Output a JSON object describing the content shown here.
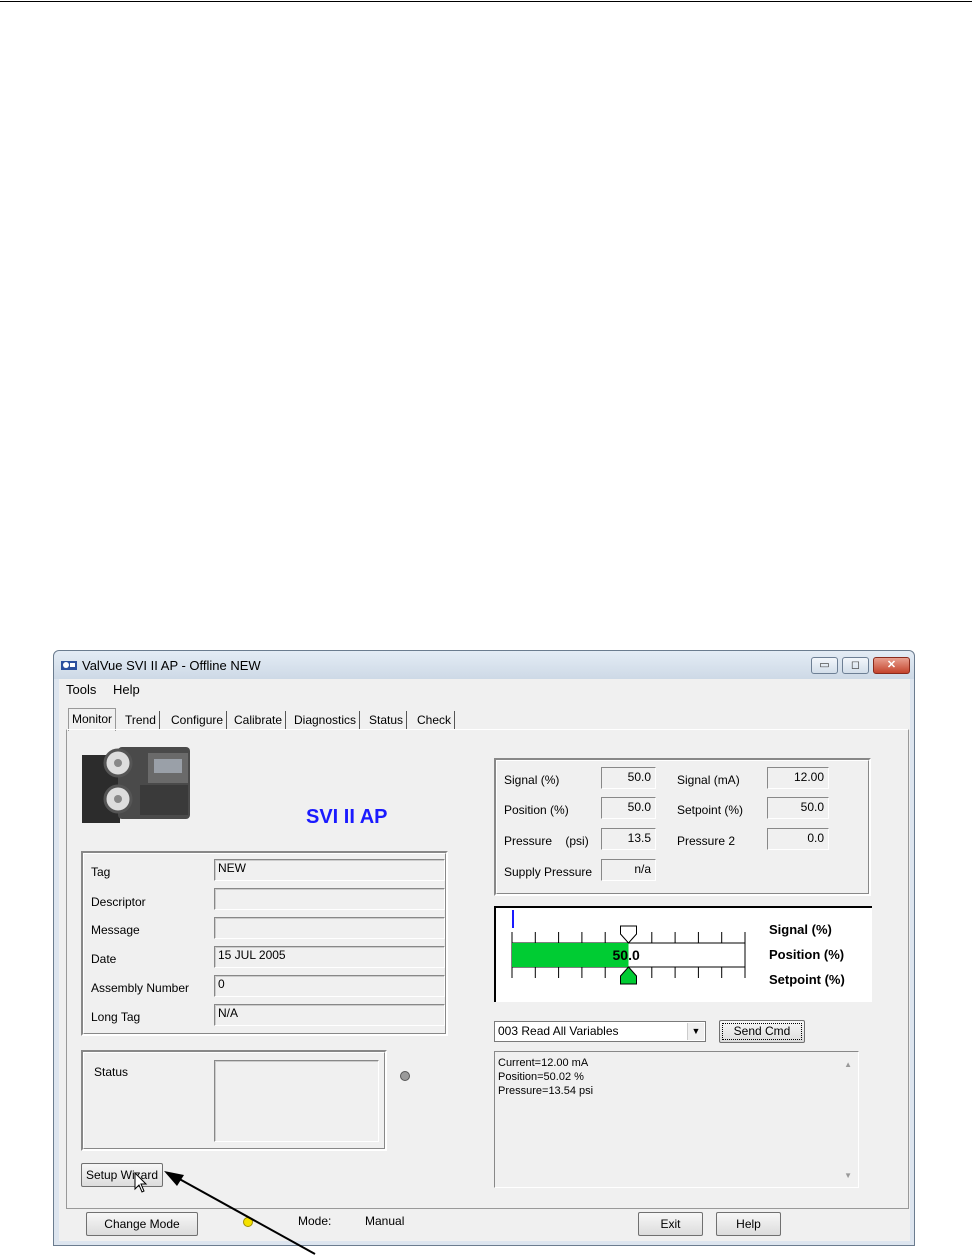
{
  "window": {
    "title": "ValVue SVI II AP - Offline  NEW",
    "controls": {
      "minimize": "▭",
      "maximize": "◻",
      "close": "✕"
    }
  },
  "menu": [
    "Tools",
    "Help"
  ],
  "tabs": [
    "Monitor",
    "Trend",
    "Configure",
    "Calibrate",
    "Diagnostics",
    "Status",
    "Check"
  ],
  "product_title": "SVI II AP",
  "info": {
    "tag_label": "Tag",
    "tag_value": "NEW",
    "descriptor_label": "Descriptor",
    "descriptor_value": "",
    "message_label": "Message",
    "message_value": "",
    "date_label": "Date",
    "date_value": "15 JUL 2005",
    "assembly_label": "Assembly Number",
    "assembly_value": "0",
    "longtag_label": "Long Tag",
    "longtag_value": "N/A"
  },
  "status": {
    "label": "Status",
    "value": ""
  },
  "buttons": {
    "setup_wizard": "Setup Wizard",
    "send_cmd": "Send Cmd",
    "change_mode": "Change Mode",
    "exit": "Exit",
    "help": "Help"
  },
  "variables": {
    "signal_pct_label": "Signal (%)",
    "signal_pct": "50.0",
    "signal_ma_label": "Signal (mA)",
    "signal_ma": "12.00",
    "position_label": "Position (%)",
    "position": "50.0",
    "setpoint_label": "Setpoint (%)",
    "setpoint": "50.0",
    "pressure_label": "Pressure    (psi)",
    "pressure": "13.5",
    "pressure2_label": "Pressure 2",
    "pressure2": "0.0",
    "supply_label": "Supply Pressure",
    "supply": "n/a"
  },
  "gauge": {
    "position_value_text": "50.0",
    "position_fraction": 0.5,
    "setpoint_fraction": 0.5,
    "signal_fraction": 0.0,
    "legend_signal": "Signal (%)",
    "legend_position": "Position (%)",
    "legend_setpoint": "Setpoint (%)",
    "bar_color": "#00cc33",
    "signal_color": "#1a1aff"
  },
  "command": {
    "selected": "003 Read All Variables",
    "output_lines": [
      "Current=12.00 mA",
      "Position=50.02 %",
      "Pressure=13.54 psi"
    ]
  },
  "mode": {
    "label": "Mode:",
    "value": "Manual"
  },
  "colors": {
    "accent": "#1a1aff",
    "led_mode": "#f5e200",
    "led_status": "#9a9a9a"
  }
}
